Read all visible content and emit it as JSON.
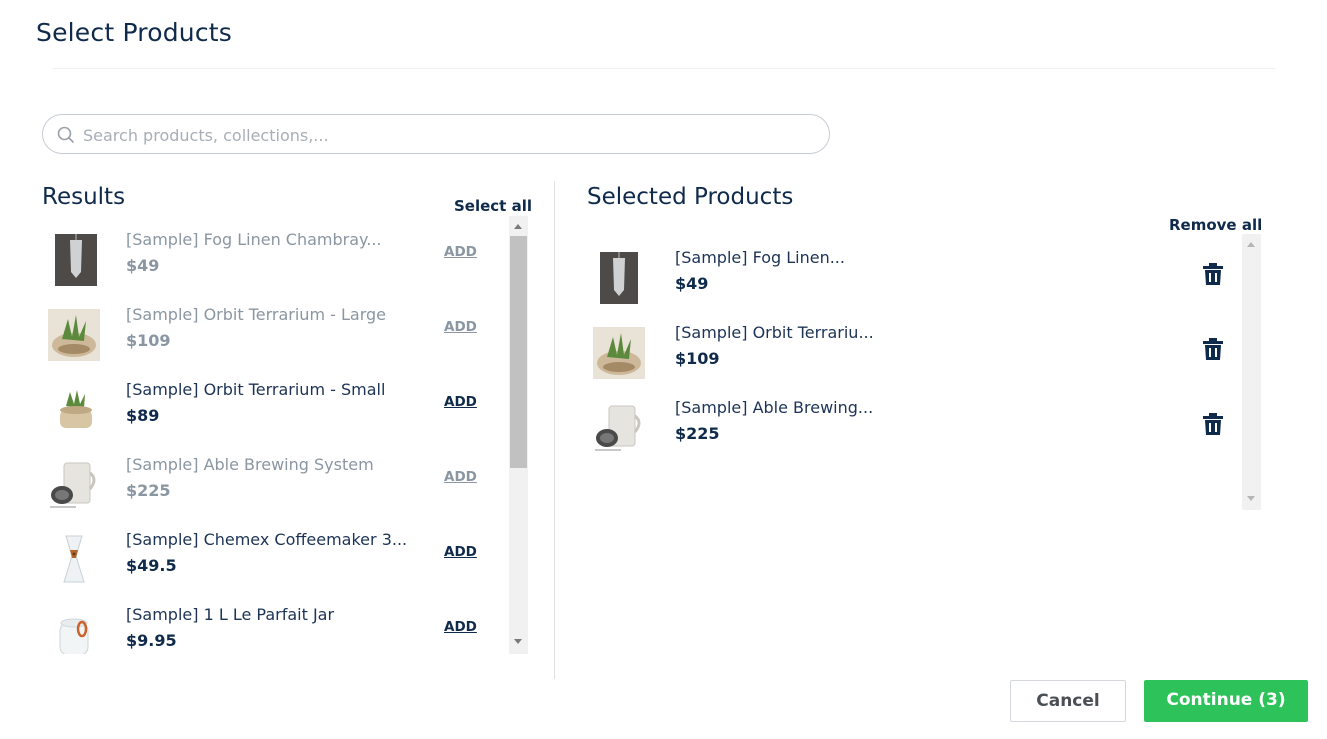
{
  "title": "Select Products",
  "search": {
    "placeholder": "Search products, collections,...",
    "value": ""
  },
  "results": {
    "heading": "Results",
    "select_all_label": "Select all",
    "items": [
      {
        "name": "[Sample] Fog Linen Chambray...",
        "price": "$49",
        "add_label": "ADD",
        "state": "added",
        "thumb": "fog-linen-towel-thumb"
      },
      {
        "name": "[Sample] Orbit Terrarium - Large",
        "price": "$109",
        "add_label": "ADD",
        "state": "added",
        "thumb": "orbit-terrarium-large-thumb"
      },
      {
        "name": "[Sample] Orbit Terrarium - Small",
        "price": "$89",
        "add_label": "ADD",
        "state": "available",
        "thumb": "orbit-terrarium-small-thumb"
      },
      {
        "name": "[Sample] Able Brewing System",
        "price": "$225",
        "add_label": "ADD",
        "state": "added",
        "thumb": "able-brewing-thumb"
      },
      {
        "name": "[Sample] Chemex Coffeemaker 3...",
        "price": "$49.5",
        "add_label": "ADD",
        "state": "available",
        "thumb": "chemex-thumb"
      },
      {
        "name": "[Sample] 1 L Le Parfait Jar",
        "price": "$9.95",
        "add_label": "ADD",
        "state": "available",
        "thumb": "le-parfait-jar-thumb"
      }
    ]
  },
  "selected": {
    "heading": "Selected Products",
    "remove_all_label": "Remove all",
    "items": [
      {
        "name": "[Sample] Fog Linen...",
        "price": "$49",
        "thumb": "fog-linen-towel-thumb",
        "remove_icon": "trash-icon"
      },
      {
        "name": "[Sample] Orbit Terrariu...",
        "price": "$109",
        "thumb": "orbit-terrarium-large-thumb",
        "remove_icon": "trash-icon"
      },
      {
        "name": "[Sample] Able Brewing...",
        "price": "$225",
        "thumb": "able-brewing-thumb",
        "remove_icon": "trash-icon"
      }
    ]
  },
  "footer": {
    "cancel_label": "Cancel",
    "continue_label": "Continue (3)"
  },
  "colors": {
    "primary_text": "#0f2a4a",
    "muted_text": "#8a96a2",
    "accent_green": "#2ec35a",
    "border": "#c6ccd3"
  }
}
